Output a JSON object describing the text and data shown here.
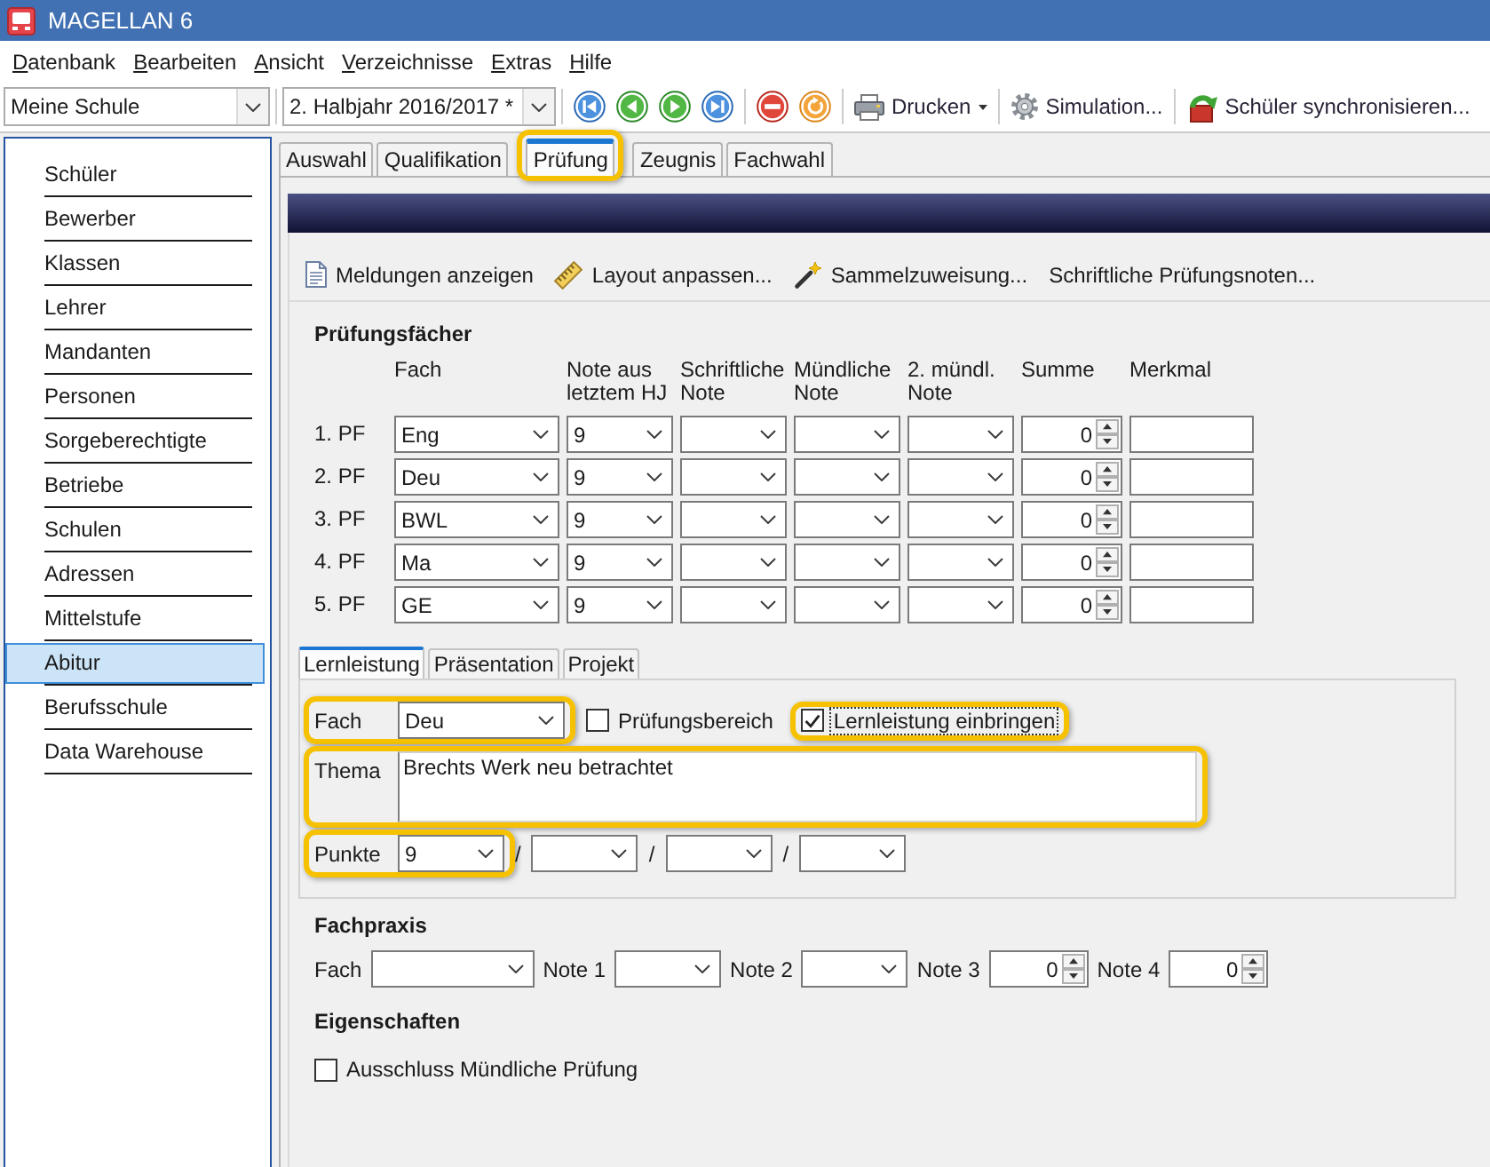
{
  "window": {
    "title": "MAGELLAN 6"
  },
  "menu": [
    "Datenbank",
    "Bearbeiten",
    "Ansicht",
    "Verzeichnisse",
    "Extras",
    "Hilfe"
  ],
  "toolbar": {
    "school": "Meine Schule",
    "term": "2. Halbjahr 2016/2017 *",
    "actions": [
      {
        "label": "Drucken",
        "dropdown": true
      },
      {
        "label": "Simulation...",
        "dropdown": false
      },
      {
        "label": "Schüler synchronisieren...",
        "dropdown": false
      }
    ]
  },
  "sidebar": {
    "items": [
      {
        "label": "Schüler",
        "selected": false
      },
      {
        "label": "Bewerber",
        "selected": false
      },
      {
        "label": "Klassen",
        "selected": false
      },
      {
        "label": "Lehrer",
        "selected": false
      },
      {
        "label": "Mandanten",
        "selected": false
      },
      {
        "label": "Personen",
        "selected": false
      },
      {
        "label": "Sorgeberechtigte",
        "selected": false
      },
      {
        "label": "Betriebe",
        "selected": false
      },
      {
        "label": "Schulen",
        "selected": false
      },
      {
        "label": "Adressen",
        "selected": false
      },
      {
        "label": "Mittelstufe",
        "selected": false
      },
      {
        "label": "Abitur",
        "selected": true
      },
      {
        "label": "Berufsschule",
        "selected": false
      },
      {
        "label": "Data Warehouse",
        "selected": false
      }
    ]
  },
  "tabs": [
    {
      "label": "Auswahl",
      "selected": false,
      "highlighted": false
    },
    {
      "label": "Qualifikation",
      "selected": false,
      "highlighted": false
    },
    {
      "label": "Prüfung",
      "selected": true,
      "highlighted": true
    },
    {
      "label": "Zeugnis",
      "selected": false,
      "highlighted": false
    },
    {
      "label": "Fachwahl",
      "selected": false,
      "highlighted": false
    }
  ],
  "commands": [
    "Meldungen anzeigen",
    "Layout anpassen...",
    "Sammelzuweisung...",
    "Schriftliche Prüfungsnoten..."
  ],
  "exam_subjects": {
    "title": "Prüfungsfächer",
    "columns": [
      {
        "label": "Fach",
        "kind": "dropdown"
      },
      {
        "label": "Note aus letztem HJ",
        "kind": "dropdown"
      },
      {
        "label": "Schriftliche Note",
        "kind": "dropdown"
      },
      {
        "label": "Mündliche Note",
        "kind": "dropdown"
      },
      {
        "label": "2. mündl. Note",
        "kind": "dropdown"
      },
      {
        "label": "Summe",
        "kind": "spinner"
      },
      {
        "label": "Merkmal",
        "kind": "text"
      }
    ],
    "rows": [
      {
        "label": "1. PF",
        "subject": "Eng",
        "last_term_grade": "9",
        "total": "0"
      },
      {
        "label": "2. PF",
        "subject": "Deu",
        "last_term_grade": "9",
        "total": "0"
      },
      {
        "label": "3. PF",
        "subject": "BWL",
        "last_term_grade": "9",
        "total": "0"
      },
      {
        "label": "4. PF",
        "subject": "Ma",
        "last_term_grade": "9",
        "total": "0"
      },
      {
        "label": "5. PF",
        "subject": "GE",
        "last_term_grade": "9",
        "total": "0"
      }
    ]
  },
  "detail_tabs": [
    {
      "label": "Lernleistung",
      "selected": true
    },
    {
      "label": "Präsentation",
      "selected": false
    },
    {
      "label": "Projekt",
      "selected": false
    }
  ],
  "detail_panel": {
    "subject": {
      "label": "Fach",
      "value": "Deu",
      "highlighted": true
    },
    "options": [
      {
        "label": "Prüfungsbereich",
        "checked": false,
        "focused": false,
        "highlighted": false
      },
      {
        "label": "Lernleistung einbringen",
        "checked": true,
        "focused": true,
        "highlighted": true
      }
    ],
    "topic": {
      "label": "Thema",
      "value": "Brechts Werk neu betrachtet",
      "highlighted": true
    },
    "points": {
      "label": "Punkte",
      "highlighted": true,
      "fields": [
        {
          "value": "9"
        },
        {
          "separator": "/"
        },
        {
          "separator": "/"
        },
        {
          "separator": "/"
        }
      ]
    }
  },
  "fachpraxis": {
    "title": "Fachpraxis",
    "fields": [
      {
        "kind": "dropdown",
        "label": "Fach"
      },
      {
        "kind": "dropdown",
        "label": "Note 1"
      },
      {
        "kind": "dropdown",
        "label": "Note 2"
      },
      {
        "kind": "spinner",
        "label": "Note 3",
        "value": "0"
      },
      {
        "kind": "spinner",
        "label": "Note 4",
        "value": "0"
      }
    ]
  },
  "eigenschaften": {
    "title": "Eigenschaften",
    "options": [
      {
        "label": "Ausschluss Mündliche Prüfung",
        "checked": false,
        "focused": false
      }
    ]
  }
}
